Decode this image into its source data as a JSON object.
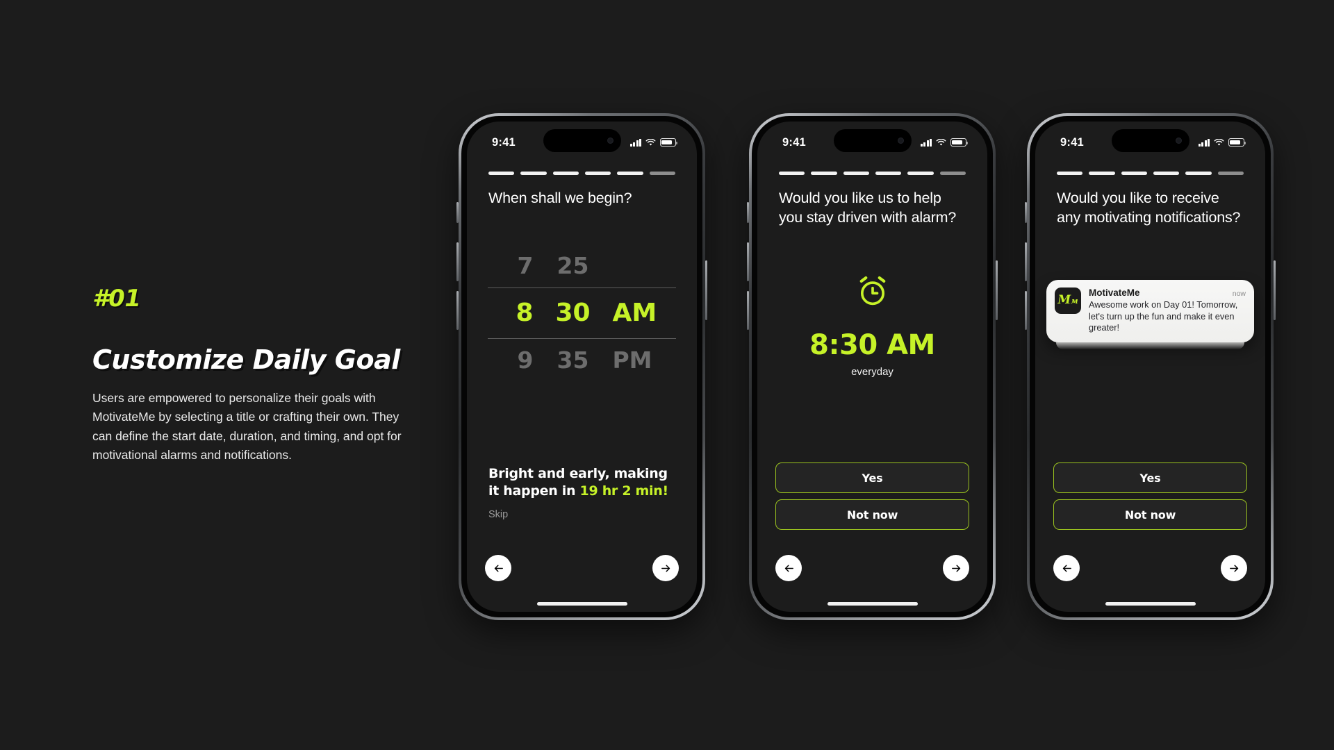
{
  "theme": {
    "background": "#1c1c1c",
    "accent": "#c6f228",
    "screen_bg": "#1c1c1c"
  },
  "copy": {
    "tag": "#01",
    "headline": "Customize Daily Goal",
    "body": "Users are empowered to personalize their goals with MotivateMe by selecting a title or crafting their own. They can define the start date, duration, and timing, and opt for motivational alarms and notifications."
  },
  "statusbar": {
    "time": "9:41",
    "signal_icon": "cellular-bars-icon",
    "wifi_icon": "wifi-icon",
    "battery_icon": "battery-icon"
  },
  "progress": {
    "total": 6,
    "active": 5
  },
  "screen1": {
    "question": "When shall we begin?",
    "picker": {
      "rows": [
        {
          "hour": "7",
          "minute": "25",
          "period": "",
          "selected": false
        },
        {
          "hour": "8",
          "minute": "30",
          "period": "AM",
          "selected": true
        },
        {
          "hour": "9",
          "minute": "35",
          "period": "PM",
          "selected": false
        }
      ]
    },
    "summary_prefix": "Bright and early, making it happen in ",
    "summary_highlight": "19 hr 2 min!",
    "skip_label": "Skip",
    "back_icon": "arrow-left-icon",
    "next_icon": "arrow-right-icon"
  },
  "screen2": {
    "question": "Would you like us to help you stay driven with alarm?",
    "alarm_icon": "alarm-clock-icon",
    "alarm_time": "8:30 AM",
    "alarm_repeat": "everyday",
    "buttons": {
      "primary": "Yes",
      "secondary": "Not now"
    },
    "back_icon": "arrow-left-icon",
    "next_icon": "arrow-right-icon"
  },
  "screen3": {
    "question": "Would you like to receive any motivating notifications?",
    "notification": {
      "app_icon_letters": {
        "big": "M",
        "small": "м"
      },
      "app_name": "MotivateMe",
      "timestamp": "now",
      "message": "Awesome work on Day 01! Tomorrow, let's turn up the fun and make it even greater!"
    },
    "buttons": {
      "primary": "Yes",
      "secondary": "Not now"
    },
    "back_icon": "arrow-left-icon",
    "next_icon": "arrow-right-icon"
  }
}
